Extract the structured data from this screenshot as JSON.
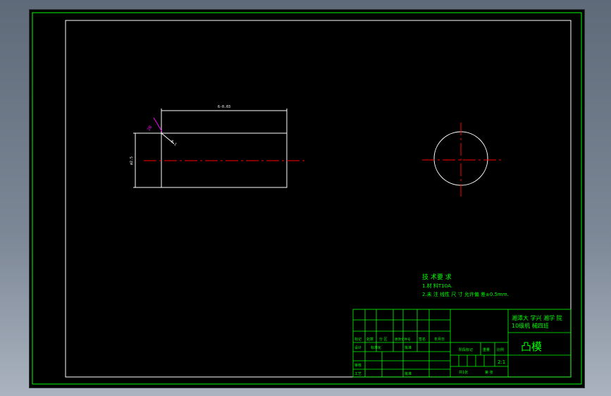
{
  "drawing": {
    "dimension_top": "6-0.03",
    "dimension_left": "ø2.5",
    "dimension_chamfer_left": "20",
    "dimension_chamfer_diag": "0.1"
  },
  "tech_requirements": {
    "title": "技 术要 求",
    "item1": "1.材 料T10A.",
    "item2": "2.未 注 线性 尺 寸 允许偏 差±0.5mm."
  },
  "title_block": {
    "school": "湘潭大 学兴 湘学 院",
    "class_label": "10级机 械四班",
    "part_name": "凸模",
    "scale": "2:1",
    "row_labels_1": [
      "标记",
      "处数",
      "分 区",
      "更改文件号",
      "签名",
      "年月日"
    ],
    "row_labels_2": [
      "设计",
      "",
      "标准化",
      "",
      "批准",
      ""
    ],
    "row_labels_3": [
      "审核",
      ""
    ],
    "row_labels_4": [
      "工艺",
      "",
      "批准",
      ""
    ],
    "mid_labels": [
      "阶段标记",
      "重量",
      "比例"
    ],
    "bottom_labels": [
      "共1张",
      "第 张"
    ]
  },
  "colors": {
    "frame": "#00ff00",
    "geometry": "#ffffff",
    "centerline": "#ff0000",
    "dimension": "#00ff00",
    "leader": "#ff00ff",
    "text": "#00ff00"
  }
}
